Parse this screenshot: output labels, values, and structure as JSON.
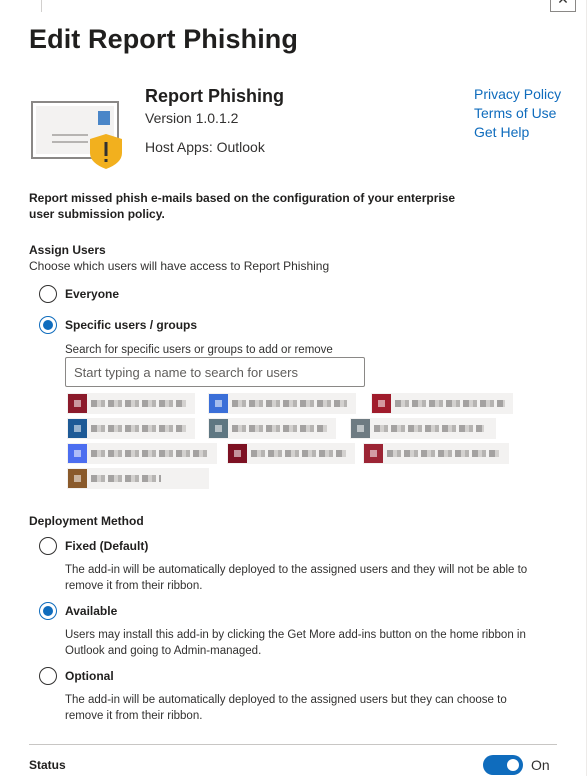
{
  "dialog": {
    "title": "Edit Report Phishing",
    "close_icon": "close-icon"
  },
  "app": {
    "name": "Report Phishing",
    "version": "Version 1.0.1.2",
    "host_apps": "Host Apps: Outlook",
    "icon": "envelope-warning-icon",
    "links": [
      "Privacy Policy",
      "Terms of Use",
      "Get Help"
    ]
  },
  "description": "Report missed phish e-mails based on the configuration of your enterprise user submission policy.",
  "assign_users": {
    "heading": "Assign Users",
    "subheading": "Choose which users will have access to Report Phishing",
    "options": [
      {
        "label": "Everyone",
        "checked": false
      },
      {
        "label": "Specific users / groups",
        "checked": true
      }
    ],
    "search_hint": "Search for specific users or groups to add or remove",
    "search_placeholder": "Start typing a name to search for users",
    "selected_users_count": 10
  },
  "deployment": {
    "heading": "Deployment Method",
    "options": [
      {
        "label": "Fixed (Default)",
        "checked": false,
        "description": "The add-in will be automatically deployed to the assigned users and they will not be able to remove it from their ribbon."
      },
      {
        "label": "Available",
        "checked": true,
        "description": "Users may install this add-in by clicking the Get More add-ins button on the home ribbon in Outlook and going to Admin-managed."
      },
      {
        "label": "Optional",
        "checked": false,
        "description": "The add-in will be automatically deployed to the assigned users but they can choose to remove it from their ribbon."
      }
    ]
  },
  "status": {
    "label": "Status",
    "toggle_state": "On",
    "enabled": true
  },
  "colors": {
    "accent": "#0f6cbd",
    "warning": "#f2b01e"
  }
}
